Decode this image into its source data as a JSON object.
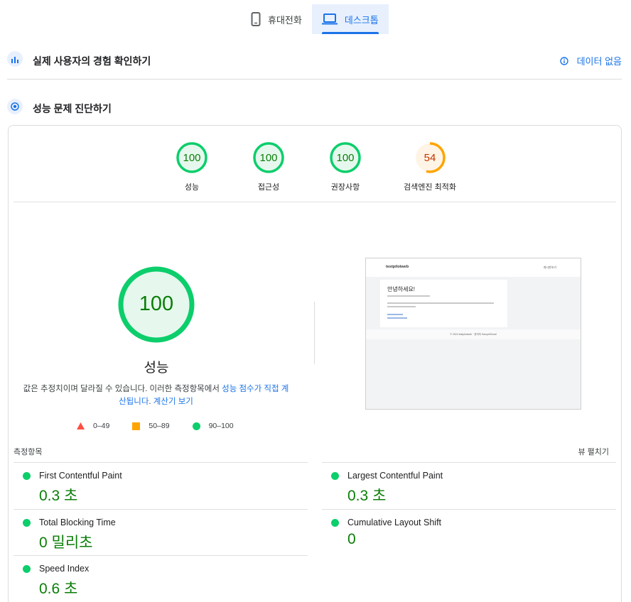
{
  "tabs": [
    {
      "label": "휴대전화",
      "icon": "mobile-phone-icon",
      "active": false
    },
    {
      "label": "데스크톱",
      "icon": "laptop-icon",
      "active": true
    }
  ],
  "crux": {
    "title": "실제 사용자의 경험 확인하기",
    "status": "데이터 없음",
    "icon": "crux-chart-icon"
  },
  "diagnose": {
    "title": "성능 문제 진단하기",
    "icon": "lighthouse-icon"
  },
  "categories": [
    {
      "label": "성능",
      "score": "100",
      "color": "#0cce6b"
    },
    {
      "label": "접근성",
      "score": "100",
      "color": "#0cce6b"
    },
    {
      "label": "권장사항",
      "score": "100",
      "color": "#0cce6b"
    },
    {
      "label": "검색엔진 최적화",
      "score": "54",
      "color": "#ffa400"
    }
  ],
  "performance": {
    "score": "100",
    "label": "성능",
    "desc_prefix": "값은 추정치이며 달라질 수 있습니다. 이러한 측정항목에서 ",
    "desc_link1": "성능 점수가 직접 계산됩니다",
    "desc_mid": ". ",
    "desc_link2": "계산기 보기"
  },
  "legend": [
    {
      "range": "0–49",
      "color": "#ff4e42",
      "shape": "triangle"
    },
    {
      "range": "50–89",
      "color": "#ffa400",
      "shape": "square"
    },
    {
      "range": "90–100",
      "color": "#0cce6b",
      "shape": "circle"
    }
  ],
  "screenshot": {
    "brand": "testpilotweb",
    "nav": "게시판보기",
    "heading": "안녕하세요!",
    "footer": "© 2024 testpilotweb · 문의처 SampleEmail"
  },
  "metrics": {
    "title": "측정항목",
    "view_toggle": "뷰 펼치기",
    "items": [
      {
        "name": "First Contentful Paint",
        "value": "0.3 초"
      },
      {
        "name": "Largest Contentful Paint",
        "value": "0.3 초"
      },
      {
        "name": "Total Blocking Time",
        "value": "0 밀리초"
      },
      {
        "name": "Cumulative Layout Shift",
        "value": "0"
      },
      {
        "name": "Speed Index",
        "value": "0.6 초"
      }
    ]
  },
  "colors": {
    "accent": "#1a73e8",
    "pass": "#0cce6b",
    "average": "#ffa400",
    "fail": "#ff4e42",
    "metric_value": "#0a7e07"
  }
}
